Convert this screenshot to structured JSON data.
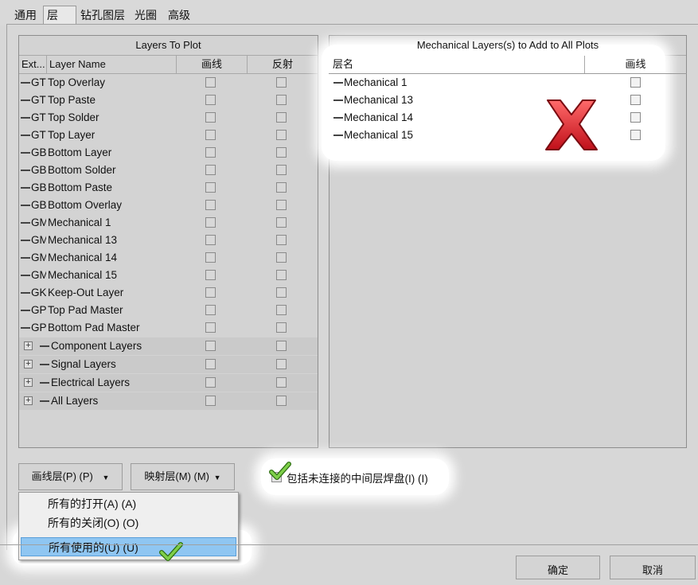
{
  "tabs": [
    "通用",
    "层",
    "钻孔图层",
    "光圈",
    "高级"
  ],
  "left_panel": {
    "title": "Layers To Plot",
    "headers": {
      "ext": "Ext...",
      "name": "Layer Name",
      "plot": "画线",
      "mirror": "反射"
    },
    "rows": [
      {
        "ext": "GT",
        "name": "Top Overlay"
      },
      {
        "ext": "GT",
        "name": "Top Paste"
      },
      {
        "ext": "GT",
        "name": "Top Solder"
      },
      {
        "ext": "GT",
        "name": "Top Layer"
      },
      {
        "ext": "GB",
        "name": "Bottom Layer"
      },
      {
        "ext": "GB",
        "name": "Bottom Solder"
      },
      {
        "ext": "GB",
        "name": "Bottom Paste"
      },
      {
        "ext": "GB",
        "name": "Bottom Overlay"
      },
      {
        "ext": "GM",
        "name": "Mechanical 1"
      },
      {
        "ext": "GM",
        "name": "Mechanical 13"
      },
      {
        "ext": "GM",
        "name": "Mechanical 14"
      },
      {
        "ext": "GM",
        "name": "Mechanical 15"
      },
      {
        "ext": "GK",
        "name": "Keep-Out Layer"
      },
      {
        "ext": "GP",
        "name": "Top Pad Master"
      },
      {
        "ext": "GP",
        "name": "Bottom Pad Master"
      }
    ],
    "groups": [
      {
        "expand": "+",
        "name": "Component Layers"
      },
      {
        "expand": "+",
        "name": "Signal Layers"
      },
      {
        "expand": "+",
        "name": "Electrical Layers"
      },
      {
        "expand": "+",
        "name": "All Layers"
      }
    ]
  },
  "right_panel": {
    "title": "Mechanical Layers(s) to Add to All Plots",
    "headers": {
      "name": "层名",
      "plot": "画线"
    },
    "rows": [
      "Mechanical 1",
      "Mechanical 13",
      "Mechanical 14",
      "Mechanical 15"
    ]
  },
  "buttons": {
    "plot_layers": "画线层(P) (P)",
    "mirror_layers": "映射层(M) (M)",
    "ok": "确定",
    "cancel": "取消"
  },
  "include_checkbox_label": "包括未连接的中间层焊盘(I) (I)",
  "menu": [
    "所有的打开(A) (A)",
    "所有的关闭(O) (O)",
    "所有使用的(U) (U)"
  ],
  "icons": {
    "red_x": "cross-icon",
    "green_check": "checkmark-icon"
  },
  "colors": {
    "red_x": "#d8202a",
    "check_green": "#6cc63a",
    "menu_selection": "#8fc6f2"
  }
}
